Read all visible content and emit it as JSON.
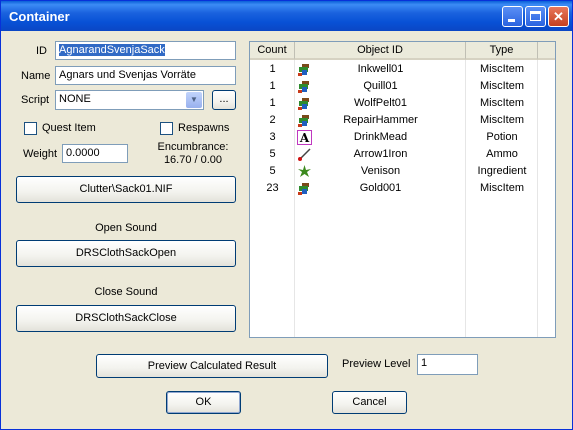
{
  "window": {
    "title": "Container"
  },
  "form": {
    "id_label": "ID",
    "id_value": "AgnarandSvenjaSack",
    "name_label": "Name",
    "name_value": "Agnars und Svenjas Vorräte",
    "script_label": "Script",
    "script_value": "NONE",
    "script_browse": "...",
    "quest_item_label": "Quest Item",
    "quest_item_checked": false,
    "respawns_label": "Respawns",
    "respawns_checked": false,
    "weight_label": "Weight",
    "weight_value": "0.0000",
    "encumbrance_label": "Encumbrance:",
    "encumbrance_value": "16.70 / 0.00",
    "model_button": "Clutter\\Sack01.NIF",
    "open_sound_label": "Open Sound",
    "open_sound_button": "DRSClothSackOpen",
    "close_sound_label": "Close Sound",
    "close_sound_button": "DRSClothSackClose"
  },
  "inventory": {
    "columns": [
      "Count",
      "Object ID",
      "Type"
    ],
    "rows": [
      {
        "count": "1",
        "object_id": "Inkwell01",
        "type": "MiscItem",
        "icon": "misc-item-icon"
      },
      {
        "count": "1",
        "object_id": "Quill01",
        "type": "MiscItem",
        "icon": "misc-item-icon"
      },
      {
        "count": "1",
        "object_id": "WolfPelt01",
        "type": "MiscItem",
        "icon": "misc-item-icon"
      },
      {
        "count": "2",
        "object_id": "RepairHammer",
        "type": "MiscItem",
        "icon": "misc-item-icon"
      },
      {
        "count": "3",
        "object_id": "DrinkMead",
        "type": "Potion",
        "icon": "potion-icon"
      },
      {
        "count": "5",
        "object_id": "Arrow1Iron",
        "type": "Ammo",
        "icon": "ammo-icon"
      },
      {
        "count": "5",
        "object_id": "Venison",
        "type": "Ingredient",
        "icon": "ingredient-icon"
      },
      {
        "count": "23",
        "object_id": "Gold001",
        "type": "MiscItem",
        "icon": "misc-item-icon"
      }
    ]
  },
  "footer": {
    "preview_button": "Preview Calculated Result",
    "preview_level_label": "Preview Level",
    "preview_level_value": "1",
    "ok_button": "OK",
    "cancel_button": "Cancel"
  },
  "colors": {
    "titlebar": "#0a5fd8",
    "dialog": "#ece9d8",
    "selection": "#316ac5"
  }
}
